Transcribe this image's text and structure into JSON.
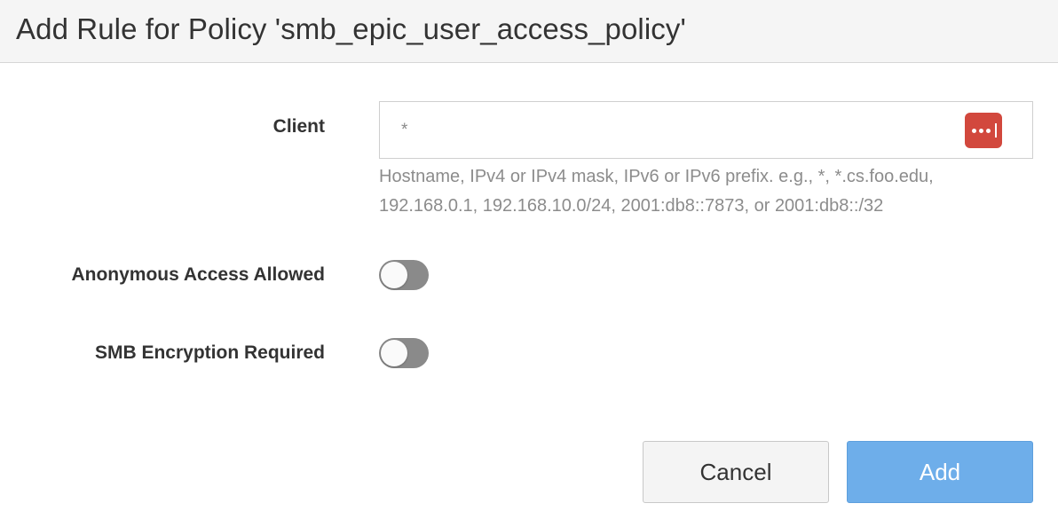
{
  "dialog": {
    "title": "Add Rule for Policy 'smb_epic_user_access_policy'"
  },
  "client": {
    "label": "Client",
    "placeholder": "*",
    "value": "",
    "hint": "Hostname, IPv4 or IPv4 mask, IPv6 or IPv6 prefix. e.g., *, *.cs.foo.edu, 192.168.0.1, 192.168.10.0/24, 2001:db8::7873, or 2001:db8::/32",
    "password_manager_icon": "password-manager-icon"
  },
  "anonymous_access": {
    "label": "Anonymous Access Allowed",
    "enabled": false
  },
  "smb_encryption": {
    "label": "SMB Encryption Required",
    "enabled": false
  },
  "buttons": {
    "cancel": "Cancel",
    "add": "Add"
  },
  "colors": {
    "add_button": "#6eaeea",
    "password_icon": "#d2483d",
    "toggle_off": "#8a8a8a"
  }
}
